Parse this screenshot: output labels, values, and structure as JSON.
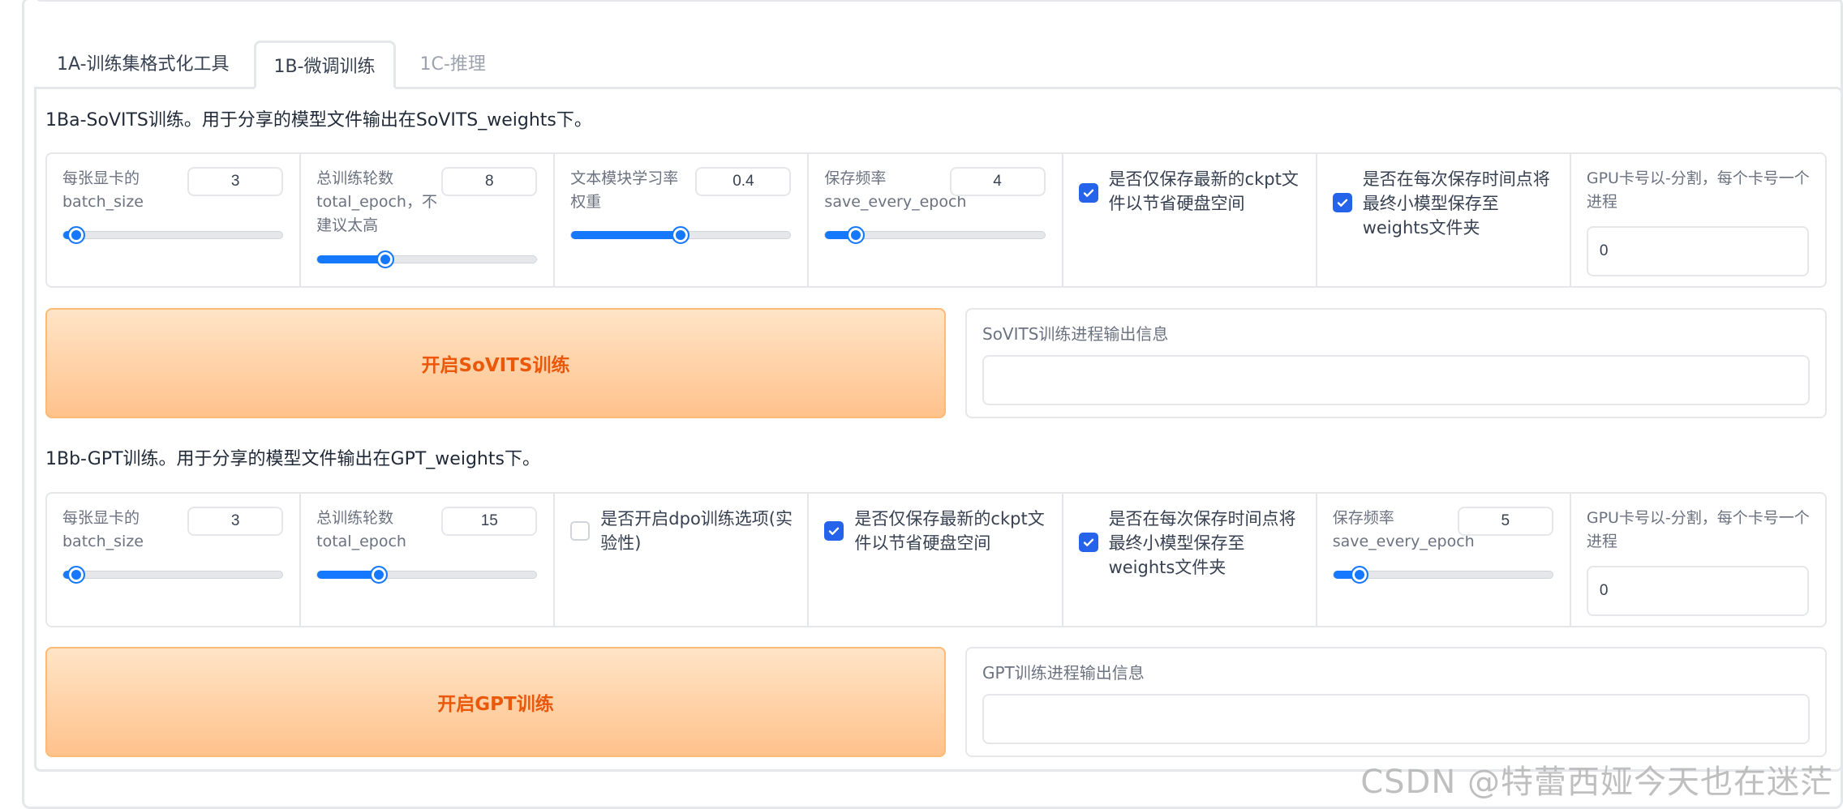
{
  "tabs": [
    {
      "label": "1A-训练集格式化工具"
    },
    {
      "label": "1B-微调训练"
    },
    {
      "label": "1C-推理"
    }
  ],
  "sovits": {
    "title": "1Ba-SoVITS训练。用于分享的模型文件输出在SoVITS_weights下。",
    "batch_size": {
      "label": "每张显卡的batch_size",
      "value": "3",
      "fraction": 0.06
    },
    "total_epoch": {
      "label": "总训练轮数total_epoch，不建议太高",
      "value": "8",
      "fraction": 0.31
    },
    "text_lr_weight": {
      "label": "文本模块学习率权重",
      "value": "0.4",
      "fraction": 0.5
    },
    "save_every_epoch": {
      "label": "保存频率save_every_epoch",
      "value": "4",
      "fraction": 0.14
    },
    "save_latest_only": {
      "label": "是否仅保存最新的ckpt文件以节省硬盘空间",
      "checked": true
    },
    "save_small_model": {
      "label": "是否在每次保存时间点将最终小模型保存至weights文件夹",
      "checked": true
    },
    "gpu_numbers": {
      "label": "GPU卡号以-分割，每个卡号一个进程",
      "value": "0"
    },
    "start_button": "开启SoVITS训练",
    "output_label": "SoVITS训练进程输出信息"
  },
  "gpt": {
    "title": "1Bb-GPT训练。用于分享的模型文件输出在GPT_weights下。",
    "batch_size": {
      "label": "每张显卡的batch_size",
      "value": "3",
      "fraction": 0.06
    },
    "total_epoch": {
      "label": "总训练轮数total_epoch",
      "value": "15",
      "fraction": 0.28
    },
    "dpo": {
      "label": "是否开启dpo训练选项(实验性)",
      "checked": false
    },
    "save_latest_only": {
      "label": "是否仅保存最新的ckpt文件以节省硬盘空间",
      "checked": true
    },
    "save_small_model": {
      "label": "是否在每次保存时间点将最终小模型保存至weights文件夹",
      "checked": true
    },
    "save_every_epoch": {
      "label": "保存频率save_every_epoch",
      "value": "5",
      "fraction": 0.12
    },
    "gpu_numbers": {
      "label": "GPU卡号以-分割，每个卡号一个进程",
      "value": "0"
    },
    "start_button": "开启GPT训练",
    "output_label": "GPT训练进程输出信息"
  },
  "colors": {
    "accent": "#1677ff",
    "button_text": "#ea580c",
    "button_bg": "#ffc28c"
  },
  "watermark": "CSDN @特蕾西娅今天也在迷茫"
}
